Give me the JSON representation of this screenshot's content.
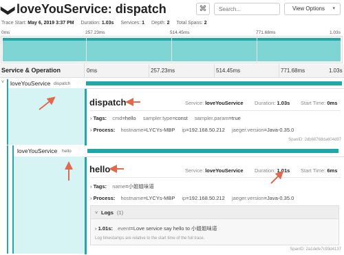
{
  "header": {
    "chevron": "❯",
    "title": "loveYouService: dispatch",
    "cmd_symbol": "⌘",
    "search_placeholder": "Search...",
    "view_options": "View Options",
    "view_options_chevron": "▾",
    "meta": {
      "trace_start_label": "Trace Start:",
      "trace_start": "May 6, 2019 3:37 PM",
      "duration_label": "Duration:",
      "duration": "1.03s",
      "services_label": "Services:",
      "services": "1",
      "depth_label": "Depth:",
      "depth": "2",
      "total_spans_label": "Total Spans:",
      "total_spans": "2"
    }
  },
  "minimap": {
    "ticks": [
      "0ms",
      "257.23ms",
      "514.45ms",
      "771.68ms",
      "1.03s"
    ]
  },
  "timeline": {
    "column_title": "Service & Operation",
    "ticks": [
      "0ms",
      "257.23ms",
      "514.45ms",
      "771.68ms",
      "1.03s"
    ]
  },
  "spans": [
    {
      "service": "loveYouService",
      "operation": "dispatch",
      "duration_fraction": 1.0,
      "detail": {
        "title": "dispatch",
        "service_label": "Service:",
        "service": "loveYouService",
        "duration_label": "Duration:",
        "duration": "1.03s",
        "start_label": "Start Time:",
        "start": "0ms",
        "tags_label": "Tags:",
        "tags": [
          {
            "k": "cmd",
            "v": "hello"
          },
          {
            "k": "sampler.type",
            "v": "const"
          },
          {
            "k": "sampler.param",
            "v": "true"
          }
        ],
        "process_label": "Process:",
        "process": [
          {
            "k": "hostname",
            "v": "LYCYs-MBP"
          },
          {
            "k": "ip",
            "v": "192.168.50.212"
          },
          {
            "k": "jaeger.version",
            "v": "Java-0.35.0"
          }
        ],
        "span_id": "SpanID: 2db66768da604d97"
      }
    },
    {
      "service": "loveYouService",
      "operation": "hello",
      "duration_fraction": 0.98,
      "detail": {
        "title": "hello",
        "service_label": "Service:",
        "service": "loveYouService",
        "duration_label": "Duration:",
        "duration": "1.01s",
        "start_label": "Start Time:",
        "start": "6ms",
        "tags_label": "Tags:",
        "tags": [
          {
            "k": "name",
            "v": "小姐姐味道"
          }
        ],
        "process_label": "Process:",
        "process": [
          {
            "k": "hostname",
            "v": "LYCYs-MBP"
          },
          {
            "k": "ip",
            "v": "192.168.50.212"
          },
          {
            "k": "jaeger.version",
            "v": "Java-0.35.0"
          }
        ],
        "logs_label": "Logs",
        "logs_count": "(1)",
        "log_time": "1.01s:",
        "log_k": "event",
        "log_v": "Love service say hello to 小姐姐味道",
        "logs_note": "Log timestamps are relative to the start time of the full trace.",
        "span_id": "SpanID: 2a1defe7c93d4137"
      }
    }
  ],
  "colors": {
    "accent": "#22a7a7",
    "arrow": "#e06a4e",
    "cyan_light": "#d6f4f4"
  }
}
